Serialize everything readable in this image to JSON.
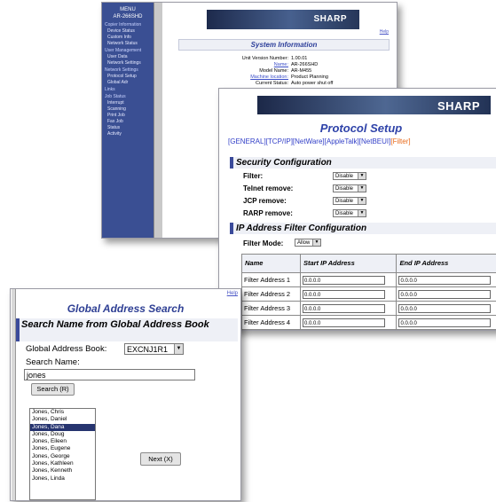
{
  "sysinfo": {
    "menu_title": [
      "MENU",
      "AR-266SHD"
    ],
    "side_sections": [
      {
        "title": "Copier Information",
        "items": [
          "Device Status",
          "Custom Info",
          "Network Status"
        ]
      },
      {
        "title": "User Management",
        "items": [
          "User Data",
          "Network Settings"
        ]
      },
      {
        "title": "Network Settings",
        "items": [
          "Protocol Setup",
          "Global Adr"
        ]
      },
      {
        "title": "Links",
        "items": []
      },
      {
        "title": "Job Status",
        "items": [
          "Interrupt",
          "Scanning",
          "Print Job",
          "Fax Job",
          "Status",
          "Activity"
        ]
      }
    ],
    "brand": "SHARP",
    "help": "Help",
    "title": "System Information",
    "rows": [
      {
        "label": "Unit Version Number:",
        "value": "1.00.01"
      },
      {
        "label": "Name:",
        "value": "AR-266SHD"
      },
      {
        "label": "Model Name:",
        "value": "AR-M455"
      },
      {
        "label": "Machine location:",
        "value": "Product Planning"
      },
      {
        "label": "Current Status:",
        "value": "Auto power shut off"
      }
    ]
  },
  "protocol": {
    "brand": "SHARP",
    "title": "Protocol Setup",
    "tabs": [
      "[GENERAL]",
      "[TCP/IP]",
      "[NetWare]",
      "[AppleTalk]",
      "[NetBEUI]",
      "[Filter]"
    ],
    "active_tab": 5,
    "security": {
      "heading": "Security Configuration",
      "rows": [
        {
          "label": "Filter:",
          "value": "Disable"
        },
        {
          "label": "Telnet remove:",
          "value": "Disable"
        },
        {
          "label": "JCP remove:",
          "value": "Disable"
        },
        {
          "label": "RARP remove:",
          "value": "Disable"
        }
      ]
    },
    "ip_filter": {
      "heading": "IP Address Filter Configuration",
      "mode_label": "Filter Mode:",
      "mode_value": "Allow",
      "columns": [
        "Name",
        "Start IP Address",
        "End IP Address"
      ],
      "rows": [
        {
          "name": "Filter Address 1",
          "start": "0.0.0.0",
          "end": "0.0.0.0"
        },
        {
          "name": "Filter Address 2",
          "start": "0.0.0.0",
          "end": "0.0.0.0"
        },
        {
          "name": "Filter Address 3",
          "start": "0.0.0.0",
          "end": "0.0.0.0"
        },
        {
          "name": "Filter Address 4",
          "start": "0.0.0.0",
          "end": "0.0.0.0"
        }
      ]
    }
  },
  "gas": {
    "help": "Help",
    "title": "Global Address Search",
    "section": "Search Name from Global Address Book",
    "book_label": "Global Address Book:",
    "book_value": "EXCNJ1R1",
    "name_label": "Search Name:",
    "name_value": "jones",
    "search_button": "Search (R)",
    "next_button": "Next (X)",
    "results": [
      "Jones, Chris",
      "Jones, Daniel",
      "Jones, Dana",
      "Jones, Doug",
      "Jones, Eileen",
      "Jones, Eugene",
      "Jones, George",
      "Jones, Kathleen",
      "Jones, Kenneth",
      "Jones, Linda"
    ],
    "selected_index": 2
  },
  "colors": {
    "accent": "#2f43a9",
    "selected": "#26346f",
    "sidebar": "#3a4f93",
    "active_tab": "#e86a1a"
  }
}
